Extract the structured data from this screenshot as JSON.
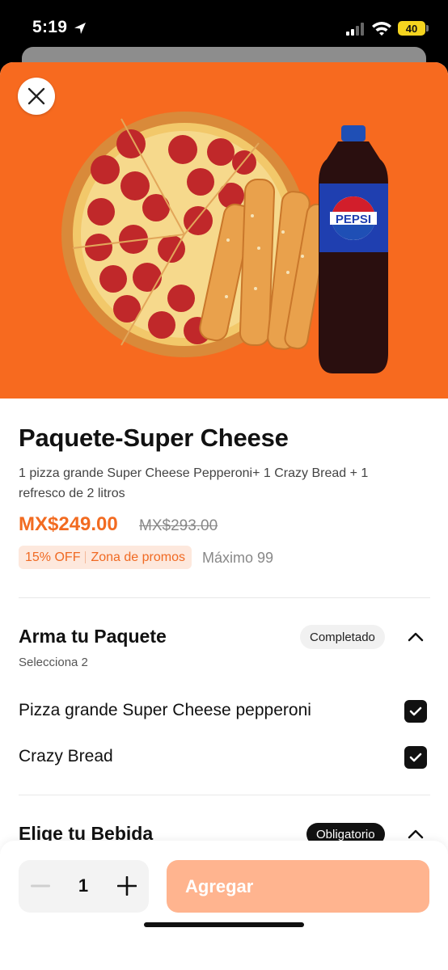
{
  "status_bar": {
    "time": "5:19",
    "battery": "40",
    "icons": [
      "location-arrow-icon",
      "signal-icon",
      "wifi-icon",
      "battery-icon"
    ]
  },
  "colors": {
    "accent": "#f26b21",
    "hero_bg": "#f76a1f",
    "add_button": "#ffb48f",
    "promo_bg": "#fde8dd"
  },
  "product": {
    "title": "Paquete-Super Cheese",
    "description": "1 pizza grande Super Cheese Pepperoni+ 1 Crazy Bread + 1 refresco de 2 litros",
    "price": "MX$249.00",
    "old_price": "MX$293.00",
    "discount": "15% OFF",
    "promo_zone": "Zona de promos",
    "max_label": "Máximo 99",
    "image_brand": "PEPSI"
  },
  "sections": [
    {
      "title": "Arma tu Paquete",
      "subtitle": "Selecciona 2",
      "status": "Completado",
      "options": [
        {
          "label": "Pizza grande Super Cheese pepperoni",
          "checked": true
        },
        {
          "label": "Crazy Bread",
          "checked": true
        }
      ]
    },
    {
      "title": "Elige tu Bebida",
      "status": "Obligatorio"
    }
  ],
  "footer": {
    "quantity": "1",
    "add_label": "Agregar"
  }
}
